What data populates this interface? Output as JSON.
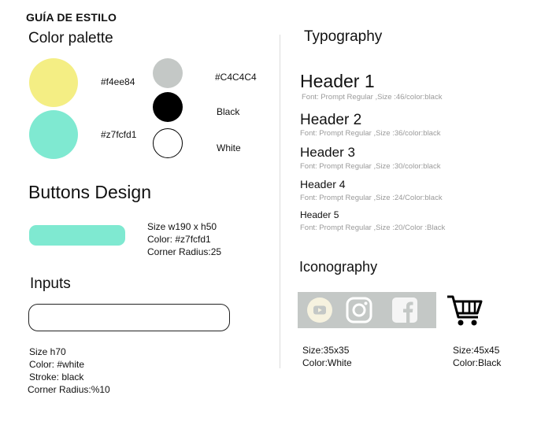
{
  "title": "GUÍA DE ESTILO",
  "color_palette": {
    "heading": "Color palette",
    "swatches": [
      {
        "label": "#f4ee84",
        "color": "#f4ee84"
      },
      {
        "label": "#z7fcfd1",
        "color": "#7fe9d1"
      },
      {
        "label": "#C4C4C4",
        "color": "#c4c8c6"
      },
      {
        "label": "Black",
        "color": "#000000"
      },
      {
        "label": "White",
        "color": "#ffffff"
      }
    ]
  },
  "buttons": {
    "heading": "Buttons Design",
    "specs": [
      "Size w190 x h50",
      "Color: #z7fcfd1",
      "Corner Radius:25"
    ]
  },
  "inputs": {
    "heading": "Inputs",
    "specs": [
      "Size h70",
      "Color: #white",
      "Stroke: black",
      "Corner Radius:%10"
    ]
  },
  "typography": {
    "heading": "Typography",
    "headers": [
      {
        "label": "Header 1",
        "note": "Font: Prompt Regular ,Size :46/color:black"
      },
      {
        "label": "Header 2",
        "note": "Font: Prompt Regular ,Size :36/color:black"
      },
      {
        "label": "Header 3",
        "note": "Font: Prompt Regular ,Size :30/color:black"
      },
      {
        "label": "Header 4",
        "note": "Font: Prompt Regular ,Size :24/Color:black"
      },
      {
        "label": "Header 5",
        "note": "Font: Prompt Regular ,Size :20/Color :Black"
      }
    ]
  },
  "iconography": {
    "heading": "Iconography",
    "icons": [
      "youtube-icon",
      "instagram-icon",
      "facebook-icon",
      "cart-icon"
    ],
    "white_icons": {
      "size": "Size:35x35",
      "color": "Color:White"
    },
    "black_icons": {
      "size": "Size:45x45",
      "color": "Color:Black"
    }
  }
}
